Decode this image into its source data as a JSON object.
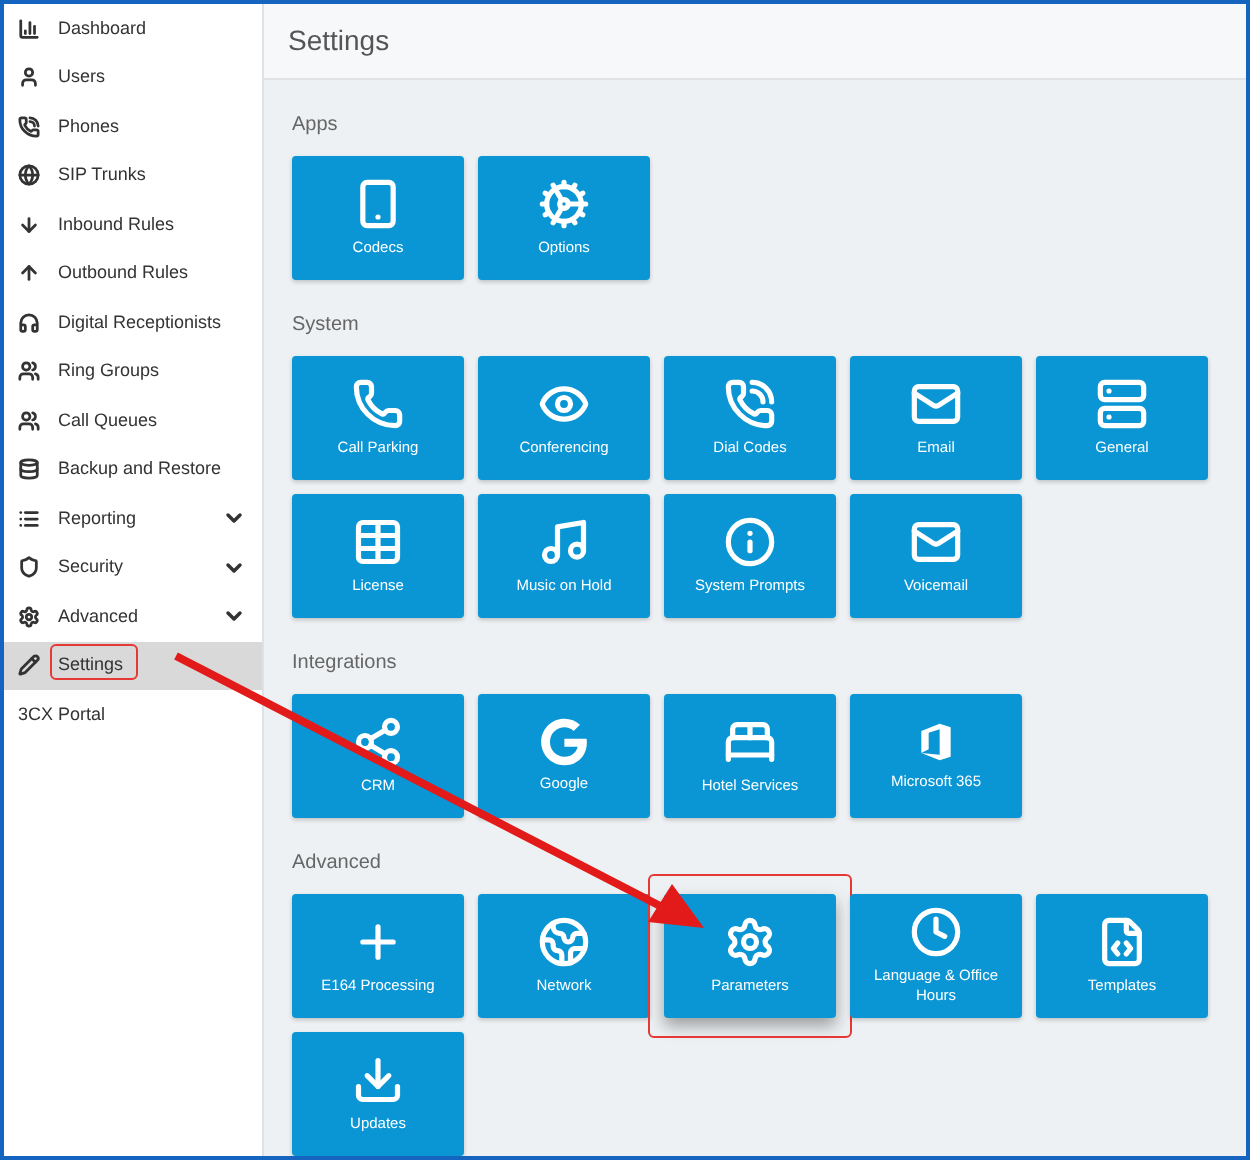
{
  "sidebar": {
    "items": [
      {
        "label": "Dashboard",
        "selected": false,
        "expandable": false,
        "highlighted": false
      },
      {
        "label": "Users",
        "selected": false,
        "expandable": false,
        "highlighted": false
      },
      {
        "label": "Phones",
        "selected": false,
        "expandable": false,
        "highlighted": false
      },
      {
        "label": "SIP Trunks",
        "selected": false,
        "expandable": false,
        "highlighted": false
      },
      {
        "label": "Inbound Rules",
        "selected": false,
        "expandable": false,
        "highlighted": false
      },
      {
        "label": "Outbound Rules",
        "selected": false,
        "expandable": false,
        "highlighted": false
      },
      {
        "label": "Digital Receptionists",
        "selected": false,
        "expandable": false,
        "highlighted": false
      },
      {
        "label": "Ring Groups",
        "selected": false,
        "expandable": false,
        "highlighted": false
      },
      {
        "label": "Call Queues",
        "selected": false,
        "expandable": false,
        "highlighted": false
      },
      {
        "label": "Backup and Restore",
        "selected": false,
        "expandable": false,
        "highlighted": false
      },
      {
        "label": "Reporting",
        "selected": false,
        "expandable": true,
        "highlighted": false
      },
      {
        "label": "Security",
        "selected": false,
        "expandable": true,
        "highlighted": false
      },
      {
        "label": "Advanced",
        "selected": false,
        "expandable": true,
        "highlighted": false
      },
      {
        "label": "Settings",
        "selected": true,
        "expandable": false,
        "highlighted": true
      },
      {
        "label": "Portal",
        "icon_text": "3CX",
        "selected": false,
        "expandable": false,
        "highlighted": false
      }
    ]
  },
  "page": {
    "title": "Settings"
  },
  "sections": [
    {
      "title": "Apps",
      "tiles": [
        {
          "label": "Codecs",
          "highlighted": false
        },
        {
          "label": "Options",
          "highlighted": false
        }
      ]
    },
    {
      "title": "System",
      "tiles": [
        {
          "label": "Call Parking",
          "highlighted": false
        },
        {
          "label": "Conferencing",
          "highlighted": false
        },
        {
          "label": "Dial Codes",
          "highlighted": false
        },
        {
          "label": "Email",
          "highlighted": false
        },
        {
          "label": "General",
          "highlighted": false
        },
        {
          "label": "License",
          "highlighted": false
        },
        {
          "label": "Music on Hold",
          "highlighted": false
        },
        {
          "label": "System Prompts",
          "highlighted": false
        },
        {
          "label": "Voicemail",
          "highlighted": false
        }
      ]
    },
    {
      "title": "Integrations",
      "tiles": [
        {
          "label": "CRM",
          "highlighted": false
        },
        {
          "label": "Google",
          "highlighted": false
        },
        {
          "label": "Hotel Services",
          "highlighted": false
        },
        {
          "label": "Microsoft 365",
          "highlighted": false
        }
      ]
    },
    {
      "title": "Advanced",
      "tiles": [
        {
          "label": "E164 Processing",
          "highlighted": false
        },
        {
          "label": "Network",
          "highlighted": false
        },
        {
          "label": "Parameters",
          "highlighted": true
        },
        {
          "label": "Language & Office Hours",
          "highlighted": false
        },
        {
          "label": "Templates",
          "highlighted": false
        },
        {
          "label": "Updates",
          "highlighted": false
        }
      ]
    }
  ]
}
